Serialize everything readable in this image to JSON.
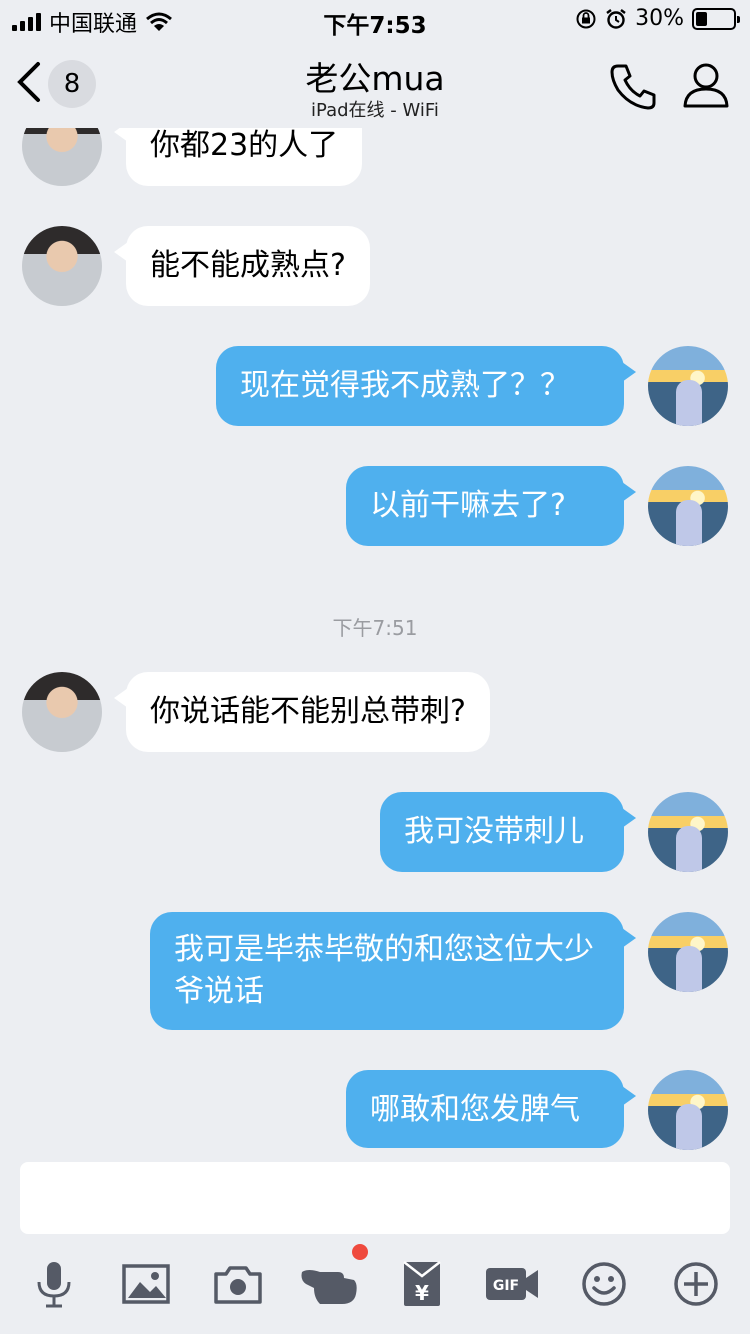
{
  "status_bar": {
    "carrier": "中国联通",
    "time": "下午7:53",
    "battery_percent": "30%",
    "battery_level": 0.3
  },
  "header": {
    "back_badge": "8",
    "title": "老公mua",
    "subtitle": "iPad在线 - WiFi"
  },
  "messages": [
    {
      "side": "left",
      "text": "你都23的人了"
    },
    {
      "side": "left",
      "text": "能不能成熟点?"
    },
    {
      "side": "right",
      "text": "现在觉得我不成熟了？？"
    },
    {
      "side": "right",
      "text": "以前干嘛去了?"
    },
    {
      "side": "left",
      "text": "你说话能不能别总带刺?"
    },
    {
      "side": "right",
      "text": "我可没带刺儿"
    },
    {
      "side": "right",
      "text": "我可是毕恭毕敬的和您这位大少爷说话"
    },
    {
      "side": "right",
      "text": "哪敢和您发脾气"
    }
  ],
  "timestamp": "下午7:51",
  "toolbar": {
    "icons": [
      "microphone-icon",
      "image-icon",
      "camera-icon",
      "poke-icon",
      "red-packet-icon",
      "gif-icon",
      "emoji-icon",
      "plus-icon"
    ],
    "gif_label": "GIF",
    "red_packet_symbol": "¥"
  },
  "colors": {
    "background": "#eceef2",
    "outgoing_bubble": "#4fb0ee",
    "incoming_bubble": "#ffffff",
    "notification_dot": "#ef4a3e"
  }
}
